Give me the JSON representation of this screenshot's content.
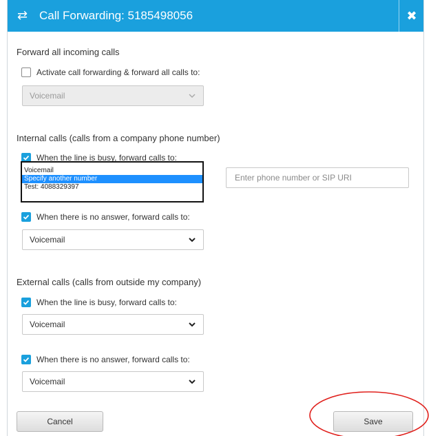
{
  "dialog": {
    "title": "Call Forwarding: 5185498056",
    "title_icon": "swap-arrows-icon",
    "close_icon": "close-icon"
  },
  "forward_all": {
    "heading": "Forward all incoming calls",
    "checkbox_label": "Activate call forwarding & forward all calls to:",
    "checked": false,
    "select_value": "Voicemail",
    "disabled": true
  },
  "internal": {
    "heading": "Internal calls (calls from a company phone number)",
    "busy_label": "When the line is busy, forward calls to:",
    "busy_checked": true,
    "dropdown_options": [
      "Voicemail",
      "Specify another number",
      "Test: 4088329397"
    ],
    "dropdown_selected": "Specify another number",
    "phone_placeholder": "Enter phone number or SIP URI",
    "no_answer_label": "When there is no answer, forward calls to:",
    "no_answer_checked": true,
    "no_answer_value": "Voicemail"
  },
  "external": {
    "heading": "External calls (calls from outside my company)",
    "busy_label": "When the line is busy, forward calls to:",
    "busy_checked": true,
    "busy_value": "Voicemail",
    "no_answer_label": "When there is no answer, forward calls to:",
    "no_answer_checked": true,
    "no_answer_value": "Voicemail"
  },
  "footer": {
    "cancel_label": "Cancel",
    "save_label": "Save"
  },
  "colors": {
    "accent": "#1aa0dd",
    "highlight_ring": "#e0201c",
    "selected_option": "#1e90ff"
  }
}
